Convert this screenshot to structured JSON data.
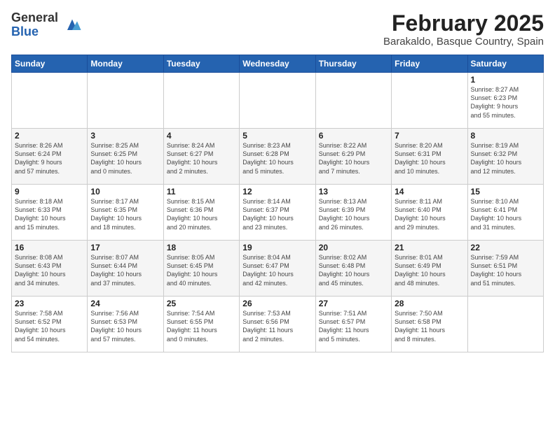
{
  "header": {
    "logo_general": "General",
    "logo_blue": "Blue",
    "title": "February 2025",
    "subtitle": "Barakaldo, Basque Country, Spain"
  },
  "days_of_week": [
    "Sunday",
    "Monday",
    "Tuesday",
    "Wednesday",
    "Thursday",
    "Friday",
    "Saturday"
  ],
  "weeks": [
    [
      {
        "day": "",
        "info": ""
      },
      {
        "day": "",
        "info": ""
      },
      {
        "day": "",
        "info": ""
      },
      {
        "day": "",
        "info": ""
      },
      {
        "day": "",
        "info": ""
      },
      {
        "day": "",
        "info": ""
      },
      {
        "day": "1",
        "info": "Sunrise: 8:27 AM\nSunset: 6:23 PM\nDaylight: 9 hours\nand 55 minutes."
      }
    ],
    [
      {
        "day": "2",
        "info": "Sunrise: 8:26 AM\nSunset: 6:24 PM\nDaylight: 9 hours\nand 57 minutes."
      },
      {
        "day": "3",
        "info": "Sunrise: 8:25 AM\nSunset: 6:25 PM\nDaylight: 10 hours\nand 0 minutes."
      },
      {
        "day": "4",
        "info": "Sunrise: 8:24 AM\nSunset: 6:27 PM\nDaylight: 10 hours\nand 2 minutes."
      },
      {
        "day": "5",
        "info": "Sunrise: 8:23 AM\nSunset: 6:28 PM\nDaylight: 10 hours\nand 5 minutes."
      },
      {
        "day": "6",
        "info": "Sunrise: 8:22 AM\nSunset: 6:29 PM\nDaylight: 10 hours\nand 7 minutes."
      },
      {
        "day": "7",
        "info": "Sunrise: 8:20 AM\nSunset: 6:31 PM\nDaylight: 10 hours\nand 10 minutes."
      },
      {
        "day": "8",
        "info": "Sunrise: 8:19 AM\nSunset: 6:32 PM\nDaylight: 10 hours\nand 12 minutes."
      }
    ],
    [
      {
        "day": "9",
        "info": "Sunrise: 8:18 AM\nSunset: 6:33 PM\nDaylight: 10 hours\nand 15 minutes."
      },
      {
        "day": "10",
        "info": "Sunrise: 8:17 AM\nSunset: 6:35 PM\nDaylight: 10 hours\nand 18 minutes."
      },
      {
        "day": "11",
        "info": "Sunrise: 8:15 AM\nSunset: 6:36 PM\nDaylight: 10 hours\nand 20 minutes."
      },
      {
        "day": "12",
        "info": "Sunrise: 8:14 AM\nSunset: 6:37 PM\nDaylight: 10 hours\nand 23 minutes."
      },
      {
        "day": "13",
        "info": "Sunrise: 8:13 AM\nSunset: 6:39 PM\nDaylight: 10 hours\nand 26 minutes."
      },
      {
        "day": "14",
        "info": "Sunrise: 8:11 AM\nSunset: 6:40 PM\nDaylight: 10 hours\nand 29 minutes."
      },
      {
        "day": "15",
        "info": "Sunrise: 8:10 AM\nSunset: 6:41 PM\nDaylight: 10 hours\nand 31 minutes."
      }
    ],
    [
      {
        "day": "16",
        "info": "Sunrise: 8:08 AM\nSunset: 6:43 PM\nDaylight: 10 hours\nand 34 minutes."
      },
      {
        "day": "17",
        "info": "Sunrise: 8:07 AM\nSunset: 6:44 PM\nDaylight: 10 hours\nand 37 minutes."
      },
      {
        "day": "18",
        "info": "Sunrise: 8:05 AM\nSunset: 6:45 PM\nDaylight: 10 hours\nand 40 minutes."
      },
      {
        "day": "19",
        "info": "Sunrise: 8:04 AM\nSunset: 6:47 PM\nDaylight: 10 hours\nand 42 minutes."
      },
      {
        "day": "20",
        "info": "Sunrise: 8:02 AM\nSunset: 6:48 PM\nDaylight: 10 hours\nand 45 minutes."
      },
      {
        "day": "21",
        "info": "Sunrise: 8:01 AM\nSunset: 6:49 PM\nDaylight: 10 hours\nand 48 minutes."
      },
      {
        "day": "22",
        "info": "Sunrise: 7:59 AM\nSunset: 6:51 PM\nDaylight: 10 hours\nand 51 minutes."
      }
    ],
    [
      {
        "day": "23",
        "info": "Sunrise: 7:58 AM\nSunset: 6:52 PM\nDaylight: 10 hours\nand 54 minutes."
      },
      {
        "day": "24",
        "info": "Sunrise: 7:56 AM\nSunset: 6:53 PM\nDaylight: 10 hours\nand 57 minutes."
      },
      {
        "day": "25",
        "info": "Sunrise: 7:54 AM\nSunset: 6:55 PM\nDaylight: 11 hours\nand 0 minutes."
      },
      {
        "day": "26",
        "info": "Sunrise: 7:53 AM\nSunset: 6:56 PM\nDaylight: 11 hours\nand 2 minutes."
      },
      {
        "day": "27",
        "info": "Sunrise: 7:51 AM\nSunset: 6:57 PM\nDaylight: 11 hours\nand 5 minutes."
      },
      {
        "day": "28",
        "info": "Sunrise: 7:50 AM\nSunset: 6:58 PM\nDaylight: 11 hours\nand 8 minutes."
      },
      {
        "day": "",
        "info": ""
      }
    ]
  ]
}
